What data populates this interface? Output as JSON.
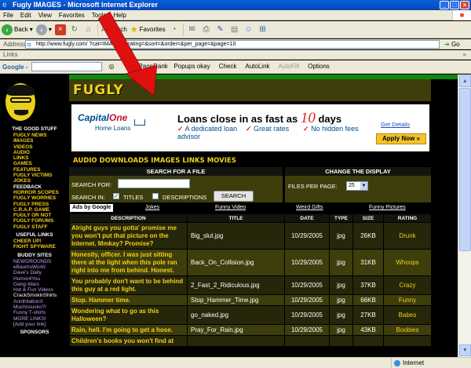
{
  "browser": {
    "title": "Fugly IMAGES - Microsoft Internet Explorer",
    "menu": [
      "File",
      "Edit",
      "View",
      "Favorites",
      "Tools",
      "Help"
    ],
    "toolbar": {
      "back": "Back",
      "search": "Search",
      "favorites": "Favorites"
    },
    "address_label": "Address",
    "address_url": "http://www.fugly.com/                     ?cat=IMAGES&rating=&sort=&order=&per_page=&page=10",
    "go_label": "Go",
    "links_label": "Links",
    "google_label": "Google -",
    "google_items": [
      "PageRank",
      "Popups okay",
      "Check",
      "AutoLink",
      "AutoFill",
      "Options"
    ],
    "status_zone": "Internet"
  },
  "site": {
    "logo": "FUGLY",
    "sidebar": {
      "good_stuff_heading": "THE GOOD STUFF",
      "good_stuff": [
        "FUGLY NEWS",
        "IMAGES",
        "VIDEOS",
        "AUDIO",
        "LINKS",
        "GAMES",
        "FEATURES",
        "FUGLY VICTIMS",
        "JOKES",
        "FEEDBACK",
        "HORROR SCOPES",
        "FUGLY WORRIES",
        "FUGLY PRESS",
        "C.R.A.P. GAME",
        "FUGLY OR NOT",
        "FUGLY FORUMS",
        "FUGLY STAFF"
      ],
      "useful_heading": "USEFUL LINKS",
      "useful": [
        "CHEER UP!",
        "FIGHT SPYWARE"
      ],
      "buddy_heading": "BUDDY SITES",
      "buddy": [
        "NEWGROUNDS",
        "eBaumsWorld",
        "Dave's Daily",
        "Humor4You",
        "Gang-Wars",
        "Hot & Fun Videos",
        "CrackSmokinShirts",
        "AnnihilationX",
        "Muchosucko?!",
        "Funny T-shirts",
        "MORE LINKS!",
        "[Add your link]"
      ],
      "sponsors_heading": "SPONSORS"
    },
    "ad": {
      "brand": "Capital",
      "brand_one": "One",
      "brand_sub": "Home Loans",
      "headline": "Loans close in as fast as",
      "headline_num": "10",
      "headline_end": "days",
      "features": [
        "A dedicated loan advisor",
        "Great rates",
        "No hidden fees"
      ],
      "details": "Get Details",
      "apply": "Apply Now »"
    },
    "subnav": [
      "AUDIO",
      "DOWNLOADS",
      "IMAGES",
      "LINKS",
      "MOVIES"
    ],
    "search": {
      "heading": "SEARCH FOR A FILE",
      "search_for": "SEARCH FOR:",
      "search_in": "SEARCH IN:",
      "titles": "TITLES",
      "descriptions": "DESCRIPTIONS",
      "button": "SEARCH"
    },
    "display": {
      "heading": "CHANGE THE DISPLAY",
      "files_per_page": "FILES PER PAGE:",
      "value": "25"
    },
    "ads_bar": {
      "label": "Ads by Google",
      "links": [
        "Jokes",
        "Funny Video",
        "Weird Gifts",
        "Funny Pictures"
      ]
    },
    "table": {
      "headers": [
        "DESCRIPTION",
        "TITLE",
        "DATE",
        "TYPE",
        "SIZE",
        "RATING"
      ],
      "rows": [
        {
          "desc": "Alright guys you gotta' promise me you won't put that picture on the Internet. Mmkay? Promise?",
          "title": "Big_slut.jpg",
          "date": "10/29/2005",
          "type": "jpg",
          "size": "26KB",
          "rating": "Drunk"
        },
        {
          "desc": "Honestly, officer. I was just sitting there at the light when this pole ran right into me from behind. Honest.",
          "title": "Back_On_Collision.jpg",
          "date": "10/29/2005",
          "type": "jpg",
          "size": "31KB",
          "rating": "Whoops"
        },
        {
          "desc": "You probably don't want to be behind this guy at a red light.",
          "title": "2_Fast_2_Ridiculous.jpg",
          "date": "10/29/2005",
          "type": "jpg",
          "size": "37KB",
          "rating": "Crazy"
        },
        {
          "desc": "Stop. Hammer time.",
          "title": "Stop_Hammer_Time.jpg",
          "date": "10/29/2005",
          "type": "jpg",
          "size": "66KB",
          "rating": "Funny"
        },
        {
          "desc": "Wondering what to go as this Halloween?",
          "title": "go_naked.jpg",
          "date": "10/29/2005",
          "type": "jpg",
          "size": "27KB",
          "rating": "Babes"
        },
        {
          "desc": "Rain, hell. I'm going to get a hose.",
          "title": "Pray_For_Rain.jpg",
          "date": "10/29/2005",
          "type": "jpg",
          "size": "43KB",
          "rating": "Boobies"
        },
        {
          "desc": "Children's books you won't find at",
          "title": "",
          "date": "",
          "type": "",
          "size": "",
          "rating": ""
        }
      ]
    }
  },
  "colors": {
    "accent_yellow": "#f2d01a",
    "panel_olive": "#3e3d0c",
    "strip_green": "#0d8a0d",
    "arrow_red": "#e01010"
  }
}
